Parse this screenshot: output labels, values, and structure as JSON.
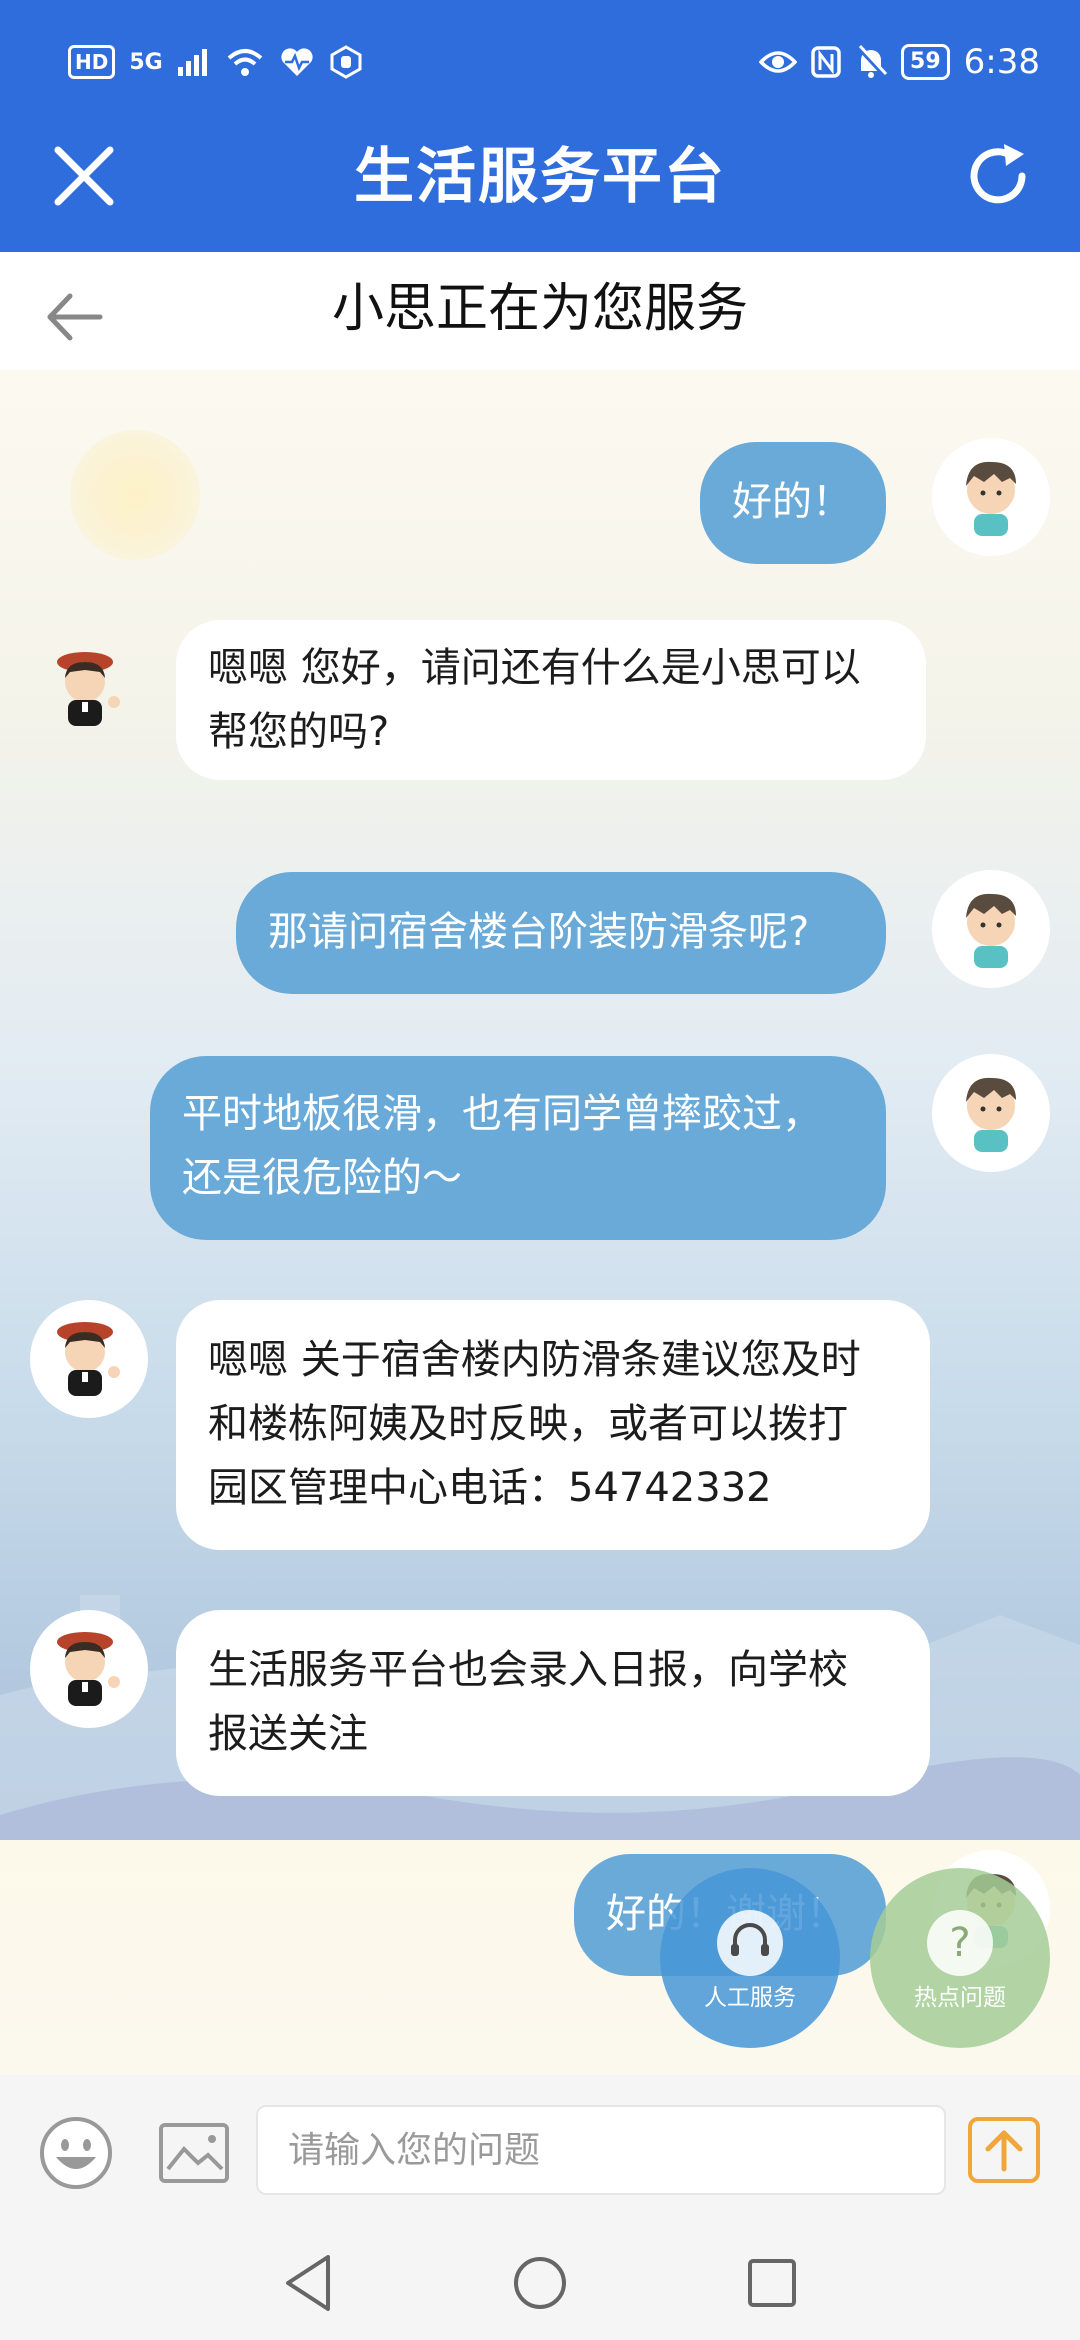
{
  "status_bar": {
    "left_items": [
      "HD",
      "5G",
      "signal",
      "6 wifi",
      "heart-monitor",
      "hand-shield"
    ],
    "hd_label": "HD",
    "network_label": "5G",
    "battery": "59",
    "time": "6:38"
  },
  "header": {
    "title": "生活服务平台"
  },
  "subheader": {
    "title": "小思正在为您服务"
  },
  "messages": [
    {
      "sender": "user",
      "lines": [
        "好的！"
      ]
    },
    {
      "sender": "bot",
      "lines": [
        "嗯嗯  您好，请问还有什么是小思可以",
        "帮您的吗?"
      ]
    },
    {
      "sender": "user",
      "lines": [
        "那请问宿舍楼台阶装防滑条呢?"
      ]
    },
    {
      "sender": "user",
      "lines": [
        "平时地板很滑，也有同学曾摔跤过，",
        "还是很危险的～"
      ]
    },
    {
      "sender": "bot",
      "lines": [
        "嗯嗯 关于宿舍楼内防滑条建议您及时",
        "和楼栋阿姨及时反映，或者可以拨打",
        "园区管理中心电话：54742332"
      ]
    },
    {
      "sender": "bot",
      "lines": [
        "生活服务平台也会录入日报，向学校",
        "报送关注"
      ]
    },
    {
      "sender": "user",
      "lines": [
        "好的！谢谢！"
      ]
    }
  ],
  "fabs": {
    "agent_label": "人工服务",
    "hot_label": "热点问题"
  },
  "input": {
    "placeholder": "请输入您的问题",
    "value": ""
  },
  "colors": {
    "header_blue": "#2f6ddc",
    "user_bubble": "#6aaad8",
    "bot_bubble": "#ffffff",
    "send_accent": "#f0a63a"
  }
}
